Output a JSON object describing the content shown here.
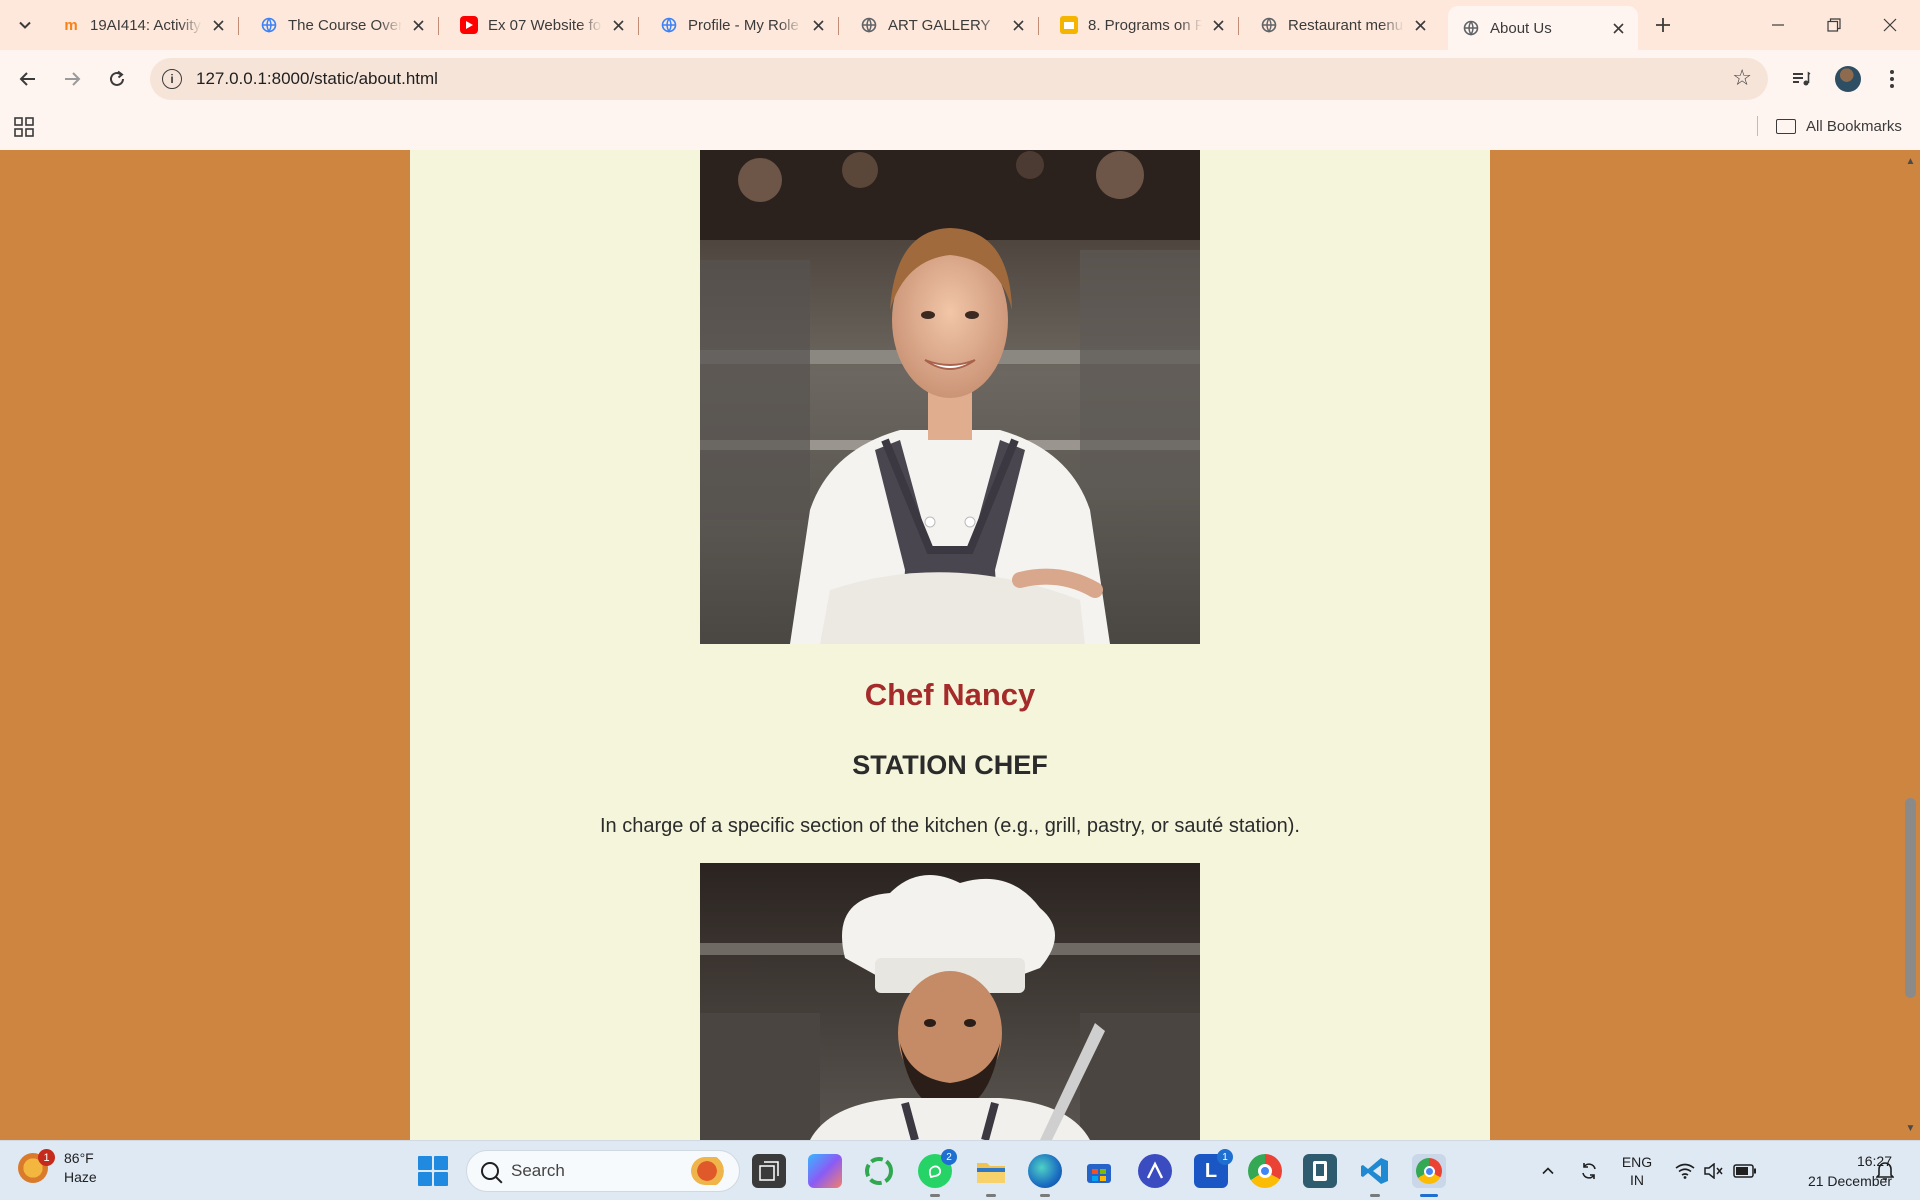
{
  "browser": {
    "tabs": [
      {
        "title": "19AI414: Activity",
        "icon": "moodle-icon",
        "color": "#f98012"
      },
      {
        "title": "The Course Over",
        "icon": "globe-blue-icon",
        "color": "#3b82f6"
      },
      {
        "title": "Ex 07 Website fo",
        "icon": "youtube-icon",
        "color": "#ff0000"
      },
      {
        "title": "Profile - My Role",
        "icon": "globe-blue-icon",
        "color": "#3b82f6"
      },
      {
        "title": "ART GALLERY",
        "icon": "globe-icon",
        "color": "#5f6368"
      },
      {
        "title": "8. Programs on P",
        "icon": "slides-icon",
        "color": "#f4b400"
      },
      {
        "title": "Restaurant menu",
        "icon": "globe-icon",
        "color": "#5f6368"
      },
      {
        "title": "About Us",
        "icon": "globe-icon",
        "color": "#5f6368",
        "active": true
      }
    ],
    "url": "127.0.0.1:8000/static/about.html",
    "bookmarks_all": "All Bookmarks"
  },
  "page": {
    "chef1": {
      "name": "Chef Nancy",
      "role": "STATION CHEF",
      "description": "In charge of a specific section of the kitchen (e.g., grill, pastry, or sauté station)."
    }
  },
  "taskbar": {
    "weather_temp": "86°F",
    "weather_cond": "Haze",
    "weather_badge": "1",
    "search_label": "Search",
    "whatsapp_badge": "2",
    "l_badge": "1",
    "lang": "ENG",
    "region": "IN",
    "time": "16:27",
    "date": "21 December"
  },
  "colors": {
    "page_bg": "#cd853f",
    "panel_bg": "#f5f5dc",
    "chef_name": "#a52a2a"
  }
}
